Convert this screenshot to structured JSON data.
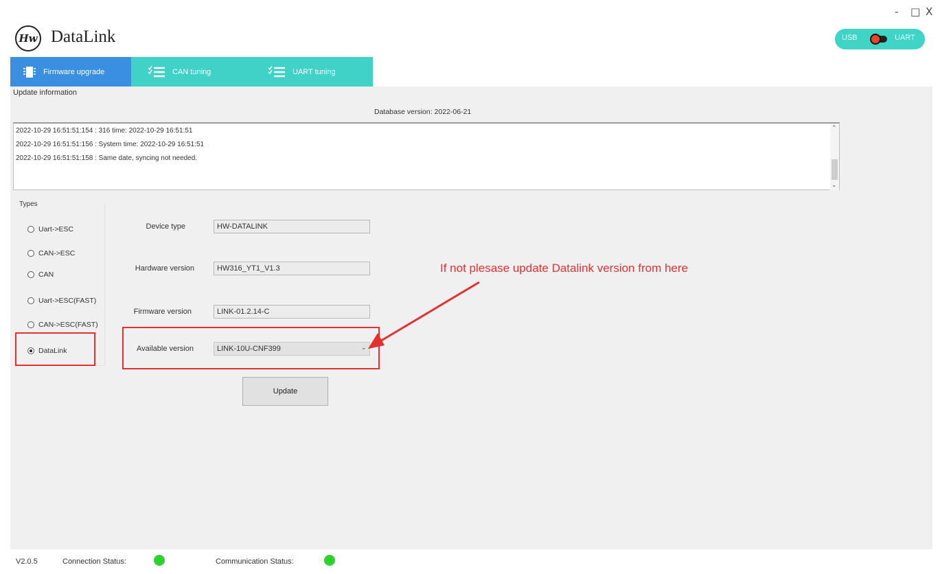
{
  "window_controls": {
    "minimize": "-",
    "maximize": "□",
    "close": "X"
  },
  "app": {
    "logo_mark": "Hw",
    "title": "DataLink"
  },
  "mode_toggle": {
    "left_label": "USB",
    "right_label": "UART",
    "selected": "UART"
  },
  "tabs": [
    {
      "label": "Firmware upgrade",
      "icon": "chip-icon",
      "active": true
    },
    {
      "label": "CAN tuning",
      "icon": "checklist-icon",
      "active": false
    },
    {
      "label": "UART tuning",
      "icon": "checklist-icon",
      "active": false
    }
  ],
  "update_info": {
    "title": "Update information",
    "database_version": "Database version: 2022-06-21",
    "log_lines": [
      "2022-10-29 16:51:51:154 : 316  time: 2022-10-29 16:51:51",
      "2022-10-29 16:51:51:156 : System time: 2022-10-29 16:51:51",
      "2022-10-29 16:51:51:158 : Same date, syncing not needed."
    ]
  },
  "types": {
    "title": "Types",
    "options": [
      {
        "label": "Uart->ESC",
        "checked": false
      },
      {
        "label": "CAN->ESC",
        "checked": false
      },
      {
        "label": "CAN",
        "checked": false
      },
      {
        "label": "Uart->ESC(FAST)",
        "checked": false
      },
      {
        "label": "CAN->ESC(FAST)",
        "checked": false
      },
      {
        "label": "DataLink",
        "checked": true
      }
    ]
  },
  "fields": {
    "device_type": {
      "label": "Device type",
      "value": "HW-DATALINK"
    },
    "hardware_version": {
      "label": "Hardware version",
      "value": "HW316_YT1_V1.3"
    },
    "firmware_version": {
      "label": "Firmware version",
      "value": "LINK-01.2.14-C"
    },
    "available_version": {
      "label": "Available version",
      "value": "LINK-10U-CNF399"
    }
  },
  "update_button": {
    "label": "Update"
  },
  "annotation": {
    "text": "If not plesase update Datalink version from here",
    "color": "#e53030"
  },
  "status_bar": {
    "version": "V2.0.5",
    "connection_label": "Connection Status:",
    "communication_label": "Communication Status:",
    "connection_ok": true,
    "communication_ok": true
  },
  "colors": {
    "tab_bar": "#40d2c6",
    "tab_active": "#3a8fe0",
    "status_ok": "#2ed12e"
  }
}
